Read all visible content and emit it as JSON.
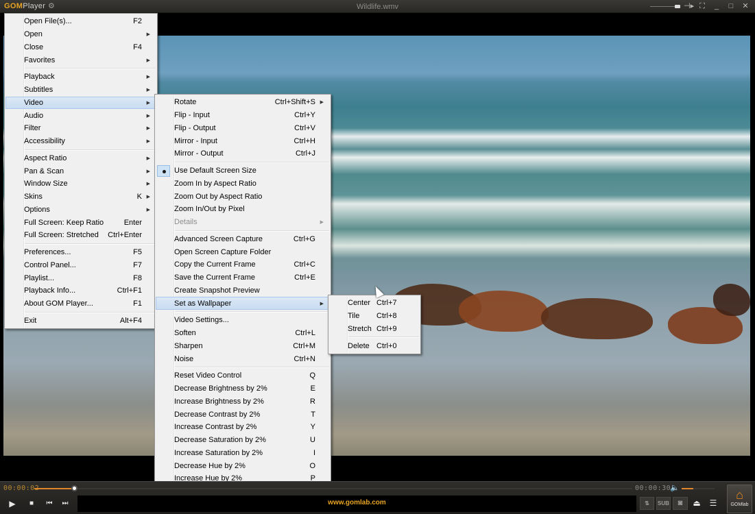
{
  "titlebar": {
    "logo_brand": "GOM",
    "logo_product": "Player",
    "gear_icon": "⚙",
    "title": "Wildlife.wmv",
    "buttons": {
      "ontop": "⊣▸",
      "fullscreen": "⛶",
      "minimize": "_",
      "maximize": "□",
      "close": "✕"
    }
  },
  "main_menu": [
    {
      "label": "Open File(s)...",
      "accel": "F2"
    },
    {
      "label": "Open",
      "submenu": true
    },
    {
      "label": "Close",
      "accel": "F4"
    },
    {
      "label": "Favorites",
      "submenu": true
    },
    {
      "separator": true
    },
    {
      "label": "Playback",
      "submenu": true
    },
    {
      "label": "Subtitles",
      "submenu": true
    },
    {
      "label": "Video",
      "submenu": true,
      "highlighted": true
    },
    {
      "label": "Audio",
      "submenu": true
    },
    {
      "label": "Filter",
      "submenu": true
    },
    {
      "label": "Accessibility",
      "submenu": true
    },
    {
      "separator": true
    },
    {
      "label": "Aspect Ratio",
      "submenu": true
    },
    {
      "label": "Pan & Scan",
      "submenu": true
    },
    {
      "label": "Window Size",
      "submenu": true
    },
    {
      "label": "Skins",
      "accel": "K",
      "submenu": true
    },
    {
      "label": "Options",
      "submenu": true
    },
    {
      "label": "Full Screen: Keep Ratio",
      "accel": "Enter"
    },
    {
      "label": "Full Screen: Stretched",
      "accel": "Ctrl+Enter"
    },
    {
      "separator": true
    },
    {
      "label": "Preferences...",
      "accel": "F5"
    },
    {
      "label": "Control Panel...",
      "accel": "F7"
    },
    {
      "label": "Playlist...",
      "accel": "F8"
    },
    {
      "label": "Playback Info...",
      "accel": "Ctrl+F1"
    },
    {
      "label": "About GOM Player...",
      "accel": "F1"
    },
    {
      "separator": true
    },
    {
      "label": "Exit",
      "accel": "Alt+F4"
    }
  ],
  "video_menu": [
    {
      "label": "Rotate",
      "accel": "Ctrl+Shift+S",
      "submenu": true
    },
    {
      "label": "Flip - Input",
      "accel": "Ctrl+Y"
    },
    {
      "label": "Flip - Output",
      "accel": "Ctrl+V"
    },
    {
      "label": "Mirror - Input",
      "accel": "Ctrl+H"
    },
    {
      "label": "Mirror - Output",
      "accel": "Ctrl+J"
    },
    {
      "separator": true
    },
    {
      "label": "Use Default Screen Size",
      "checked": true
    },
    {
      "label": "Zoom In by Aspect Ratio"
    },
    {
      "label": "Zoom Out by Aspect Ratio"
    },
    {
      "label": "Zoom In/Out by Pixel"
    },
    {
      "label": "Details",
      "submenu": true,
      "disabled": true
    },
    {
      "separator": true
    },
    {
      "label": "Advanced Screen Capture",
      "accel": "Ctrl+G"
    },
    {
      "label": "Open Screen Capture Folder"
    },
    {
      "label": "Copy the Current Frame",
      "accel": "Ctrl+C"
    },
    {
      "label": "Save the Current Frame",
      "accel": "Ctrl+E"
    },
    {
      "label": "Create Snapshot Preview"
    },
    {
      "label": "Set as Wallpaper",
      "submenu": true,
      "highlighted": true
    },
    {
      "separator": true
    },
    {
      "label": "Video Settings..."
    },
    {
      "label": "Soften",
      "accel": "Ctrl+L"
    },
    {
      "label": "Sharpen",
      "accel": "Ctrl+M"
    },
    {
      "label": "Noise",
      "accel": "Ctrl+N"
    },
    {
      "separator": true
    },
    {
      "label": "Reset Video Control",
      "accel": "Q"
    },
    {
      "label": "Decrease Brightness by 2%",
      "accel": "E"
    },
    {
      "label": "Increase Brightness by 2%",
      "accel": "R"
    },
    {
      "label": "Decrease Contrast by 2%",
      "accel": "T"
    },
    {
      "label": "Increase Contrast by 2%",
      "accel": "Y"
    },
    {
      "label": "Decrease Saturation by 2%",
      "accel": "U"
    },
    {
      "label": "Increase Saturation by 2%",
      "accel": "I"
    },
    {
      "label": "Decrease Hue by 2%",
      "accel": "O"
    },
    {
      "label": "Increase Hue by 2%",
      "accel": "P"
    }
  ],
  "wallpaper_menu": [
    {
      "label": "Center",
      "accel": "Ctrl+7"
    },
    {
      "label": "Tile",
      "accel": "Ctrl+8"
    },
    {
      "label": "Stretch",
      "accel": "Ctrl+9"
    },
    {
      "separator": true
    },
    {
      "label": "Delete",
      "accel": "Ctrl+0"
    }
  ],
  "controls": {
    "current_time": "00:00:02",
    "total_time": "00:00:30",
    "seek_progress": 0.067,
    "volume_level": 0.35,
    "play_icon": "▶",
    "stop_icon": "■",
    "prev_icon": "⏮",
    "next_icon": "⏭",
    "banner_text": "www.gomlab.com",
    "eq_label": "⇅",
    "sub_label": "SUB",
    "capture_icon": "◙",
    "eject_icon": "⏏",
    "playlist_icon": "☰",
    "home_icon": "⌂",
    "home_label": "GOMlab",
    "volume_icon": "🔈"
  },
  "colors": {
    "accent": "#e0872e",
    "brand": "#e8a423",
    "menu_highlight": "#cde0f3"
  }
}
